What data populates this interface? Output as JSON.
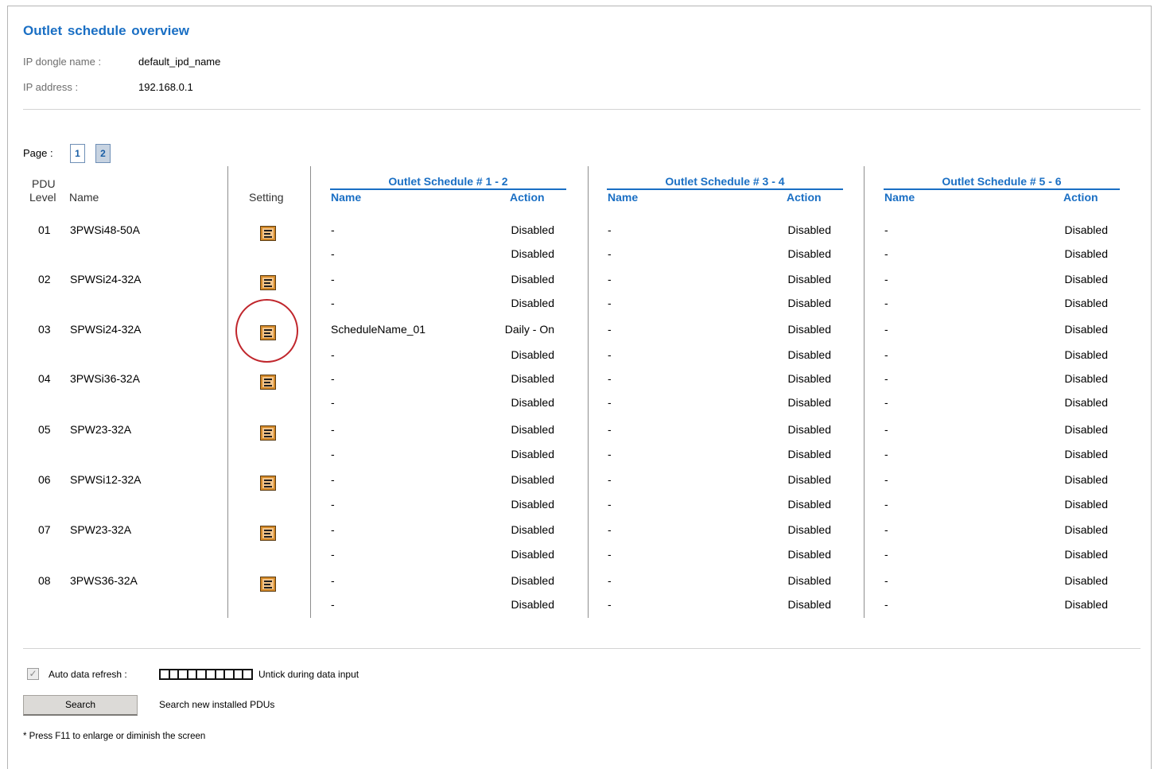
{
  "title": "Outlet schedule overview",
  "info": {
    "dongle_label": "IP dongle name :",
    "dongle_value": "default_ipd_name",
    "ip_label": "IP address :",
    "ip_value": "192.168.0.1"
  },
  "pagination": {
    "label": "Page :",
    "pages": [
      "1",
      "2"
    ],
    "active": "2"
  },
  "headers": {
    "pdu": "PDU",
    "level": "Level",
    "name": "Name",
    "setting": "Setting",
    "groups": [
      "Outlet Schedule # 1 - 2",
      "Outlet Schedule # 3 - 4",
      "Outlet Schedule # 5 - 6"
    ],
    "sub_name": "Name",
    "sub_action": "Action"
  },
  "rows": [
    {
      "level": "01",
      "name": "3PWSi48-50A",
      "g1": [
        {
          "n": "-",
          "a": "Disabled"
        },
        {
          "n": "-",
          "a": "Disabled"
        }
      ],
      "g2": [
        {
          "n": "-",
          "a": "Disabled"
        },
        {
          "n": "-",
          "a": "Disabled"
        }
      ],
      "g3": [
        {
          "n": "-",
          "a": "Disabled"
        },
        {
          "n": "-",
          "a": "Disabled"
        }
      ]
    },
    {
      "level": "02",
      "name": "SPWSi24-32A",
      "g1": [
        {
          "n": "-",
          "a": "Disabled"
        },
        {
          "n": "-",
          "a": "Disabled"
        }
      ],
      "g2": [
        {
          "n": "-",
          "a": "Disabled"
        },
        {
          "n": "-",
          "a": "Disabled"
        }
      ],
      "g3": [
        {
          "n": "-",
          "a": "Disabled"
        },
        {
          "n": "-",
          "a": "Disabled"
        }
      ]
    },
    {
      "level": "03",
      "name": "SPWSi24-32A",
      "g1": [
        {
          "n": "ScheduleName_01",
          "a": "Daily - On"
        },
        {
          "n": "-",
          "a": "Disabled"
        }
      ],
      "g2": [
        {
          "n": "-",
          "a": "Disabled"
        },
        {
          "n": "-",
          "a": "Disabled"
        }
      ],
      "g3": [
        {
          "n": "-",
          "a": "Disabled"
        },
        {
          "n": "-",
          "a": "Disabled"
        }
      ]
    },
    {
      "level": "04",
      "name": "3PWSi36-32A",
      "g1": [
        {
          "n": "-",
          "a": "Disabled"
        },
        {
          "n": "-",
          "a": "Disabled"
        }
      ],
      "g2": [
        {
          "n": "-",
          "a": "Disabled"
        },
        {
          "n": "-",
          "a": "Disabled"
        }
      ],
      "g3": [
        {
          "n": "-",
          "a": "Disabled"
        },
        {
          "n": "-",
          "a": "Disabled"
        }
      ]
    },
    {
      "level": "05",
      "name": "SPW23-32A",
      "g1": [
        {
          "n": "-",
          "a": "Disabled"
        },
        {
          "n": "-",
          "a": "Disabled"
        }
      ],
      "g2": [
        {
          "n": "-",
          "a": "Disabled"
        },
        {
          "n": "-",
          "a": "Disabled"
        }
      ],
      "g3": [
        {
          "n": "-",
          "a": "Disabled"
        },
        {
          "n": "-",
          "a": "Disabled"
        }
      ]
    },
    {
      "level": "06",
      "name": "SPWSi12-32A",
      "g1": [
        {
          "n": "-",
          "a": "Disabled"
        },
        {
          "n": "-",
          "a": "Disabled"
        }
      ],
      "g2": [
        {
          "n": "-",
          "a": "Disabled"
        },
        {
          "n": "-",
          "a": "Disabled"
        }
      ],
      "g3": [
        {
          "n": "-",
          "a": "Disabled"
        },
        {
          "n": "-",
          "a": "Disabled"
        }
      ]
    },
    {
      "level": "07",
      "name": "SPW23-32A",
      "g1": [
        {
          "n": "-",
          "a": "Disabled"
        },
        {
          "n": "-",
          "a": "Disabled"
        }
      ],
      "g2": [
        {
          "n": "-",
          "a": "Disabled"
        },
        {
          "n": "-",
          "a": "Disabled"
        }
      ],
      "g3": [
        {
          "n": "-",
          "a": "Disabled"
        },
        {
          "n": "-",
          "a": "Disabled"
        }
      ]
    },
    {
      "level": "08",
      "name": "3PWS36-32A",
      "g1": [
        {
          "n": "-",
          "a": "Disabled"
        },
        {
          "n": "-",
          "a": "Disabled"
        }
      ],
      "g2": [
        {
          "n": "-",
          "a": "Disabled"
        },
        {
          "n": "-",
          "a": "Disabled"
        }
      ],
      "g3": [
        {
          "n": "-",
          "a": "Disabled"
        },
        {
          "n": "-",
          "a": "Disabled"
        }
      ]
    }
  ],
  "icons": {
    "setting": "settings-list-icon"
  },
  "colors": {
    "accent": "#1a6fc4",
    "icon_fill": "#d48a2a",
    "highlight": "#c0262c"
  },
  "footer": {
    "auto_refresh_label": "Auto data refresh :",
    "auto_refresh_checked": true,
    "untick_hint": "Untick during data input",
    "search_button": "Search",
    "search_hint": "Search new installed PDUs",
    "note": "* Press F11 to enlarge or diminish the screen"
  }
}
